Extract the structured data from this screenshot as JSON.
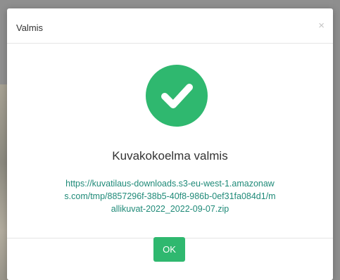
{
  "dialog": {
    "title": "Valmis",
    "close_symbol": "×",
    "headline": "Kuvakokoelma valmis",
    "download_url": "https://kuvatilaus-downloads.s3-eu-west-1.amazonaws.com/tmp/8857296f-38b5-40f8-986b-0ef31fa084d1/mallikuvat-2022_2022-09-07.zip",
    "ok_label": "OK"
  },
  "icons": {
    "success": "check-circle-icon",
    "close": "close-icon"
  },
  "colors": {
    "success_green": "#2fb86f",
    "link": "#1f8a78",
    "text": "#333333",
    "close": "#c4c4c4"
  }
}
